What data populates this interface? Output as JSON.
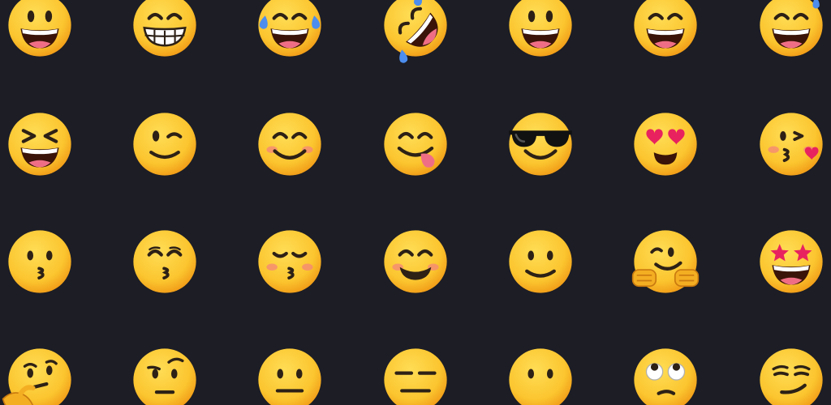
{
  "colors": {
    "background": "#1c1d25",
    "face": "#fbc52f",
    "face_shade": "#f19d18",
    "feature": "#2d2116",
    "mouth": "#3a1408",
    "tongue": "#ef6e86",
    "teeth": "#ffffff",
    "tear": "#4c8ded",
    "heart": "#e8225f",
    "blush": "#f4847a",
    "hand": "#f4ae22"
  },
  "grid": {
    "rows": [
      [
        "grinning-face-with-big-eyes",
        "beaming-face-with-smiling-eyes",
        "face-with-tears-of-joy",
        "rolling-on-the-floor-laughing",
        "grinning-face",
        "grinning-face-with-smiling-eyes",
        "grinning-face-with-sweat"
      ],
      [
        "grinning-squinting-face",
        "winking-face",
        "smiling-face-with-smiling-eyes",
        "face-savoring-food",
        "smiling-face-with-sunglasses",
        "smiling-face-with-heart-eyes",
        "face-blowing-a-kiss"
      ],
      [
        "kissing-face",
        "kissing-face-with-smiling-eyes",
        "kissing-face-with-closed-eyes",
        "blushing-smiling-face",
        "slightly-smiling-face",
        "hugging-face",
        "star-struck"
      ],
      [
        "thinking-face",
        "face-with-raised-eyebrow",
        "neutral-face",
        "expressionless-face",
        "face-without-mouth",
        "face-with-rolling-eyes",
        "smirking-face"
      ]
    ]
  }
}
